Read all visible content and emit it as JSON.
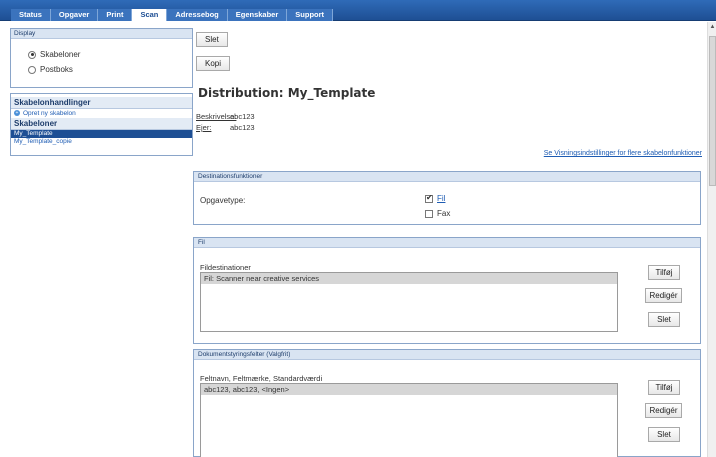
{
  "nav": {
    "tabs": [
      {
        "label": "Status"
      },
      {
        "label": "Opgaver"
      },
      {
        "label": "Print"
      },
      {
        "label": "Scan"
      },
      {
        "label": "Adressebog"
      },
      {
        "label": "Egenskaber"
      },
      {
        "label": "Support"
      }
    ],
    "active": "Scan"
  },
  "sidebar": {
    "display": {
      "title": "Display",
      "options": [
        {
          "label": "Skabeloner",
          "selected": true
        },
        {
          "label": "Postboks",
          "selected": false
        }
      ]
    },
    "actions": {
      "title": "Skabelonhandlinger",
      "create_link": "Opret ny skabelon"
    },
    "templates": {
      "title": "Skabeloner",
      "items": [
        {
          "label": "My_Template",
          "selected": true
        },
        {
          "label": "My_Template_copie",
          "selected": false
        }
      ]
    }
  },
  "main": {
    "delete_button": "Slet",
    "copy_button": "Kopi",
    "title": "Distribution: My_Template",
    "description_label": "Beskrivelse:",
    "description_value": "abc123",
    "owner_label": "Ejer:",
    "owner_value": "abc123",
    "view_settings_link": "Se Visningsindstillinger for flere skabelonfunktioner",
    "destination_panel": {
      "title": "Destinationsfunktioner",
      "job_type_label": "Opgavetype:",
      "options": [
        {
          "label": "Fil",
          "checked": true
        },
        {
          "label": "Fax",
          "checked": false
        }
      ]
    },
    "file_panel": {
      "title": "Fil",
      "list_label": "Fildestinationer",
      "entries": [
        "Fil: Scanner near creative services"
      ],
      "add_button": "Tilføj",
      "edit_button": "Redigér",
      "delete_button": "Slet"
    },
    "doc_panel": {
      "title": "Dokumentstyringsfelter (Valgfrit)",
      "list_label": "Feltnavn, Feltmærke, Standardværdi",
      "entries": [
        "abc123, abc123, <Ingen>"
      ],
      "add_button": "Tilføj",
      "edit_button": "Redigér",
      "delete_button": "Slet"
    }
  }
}
